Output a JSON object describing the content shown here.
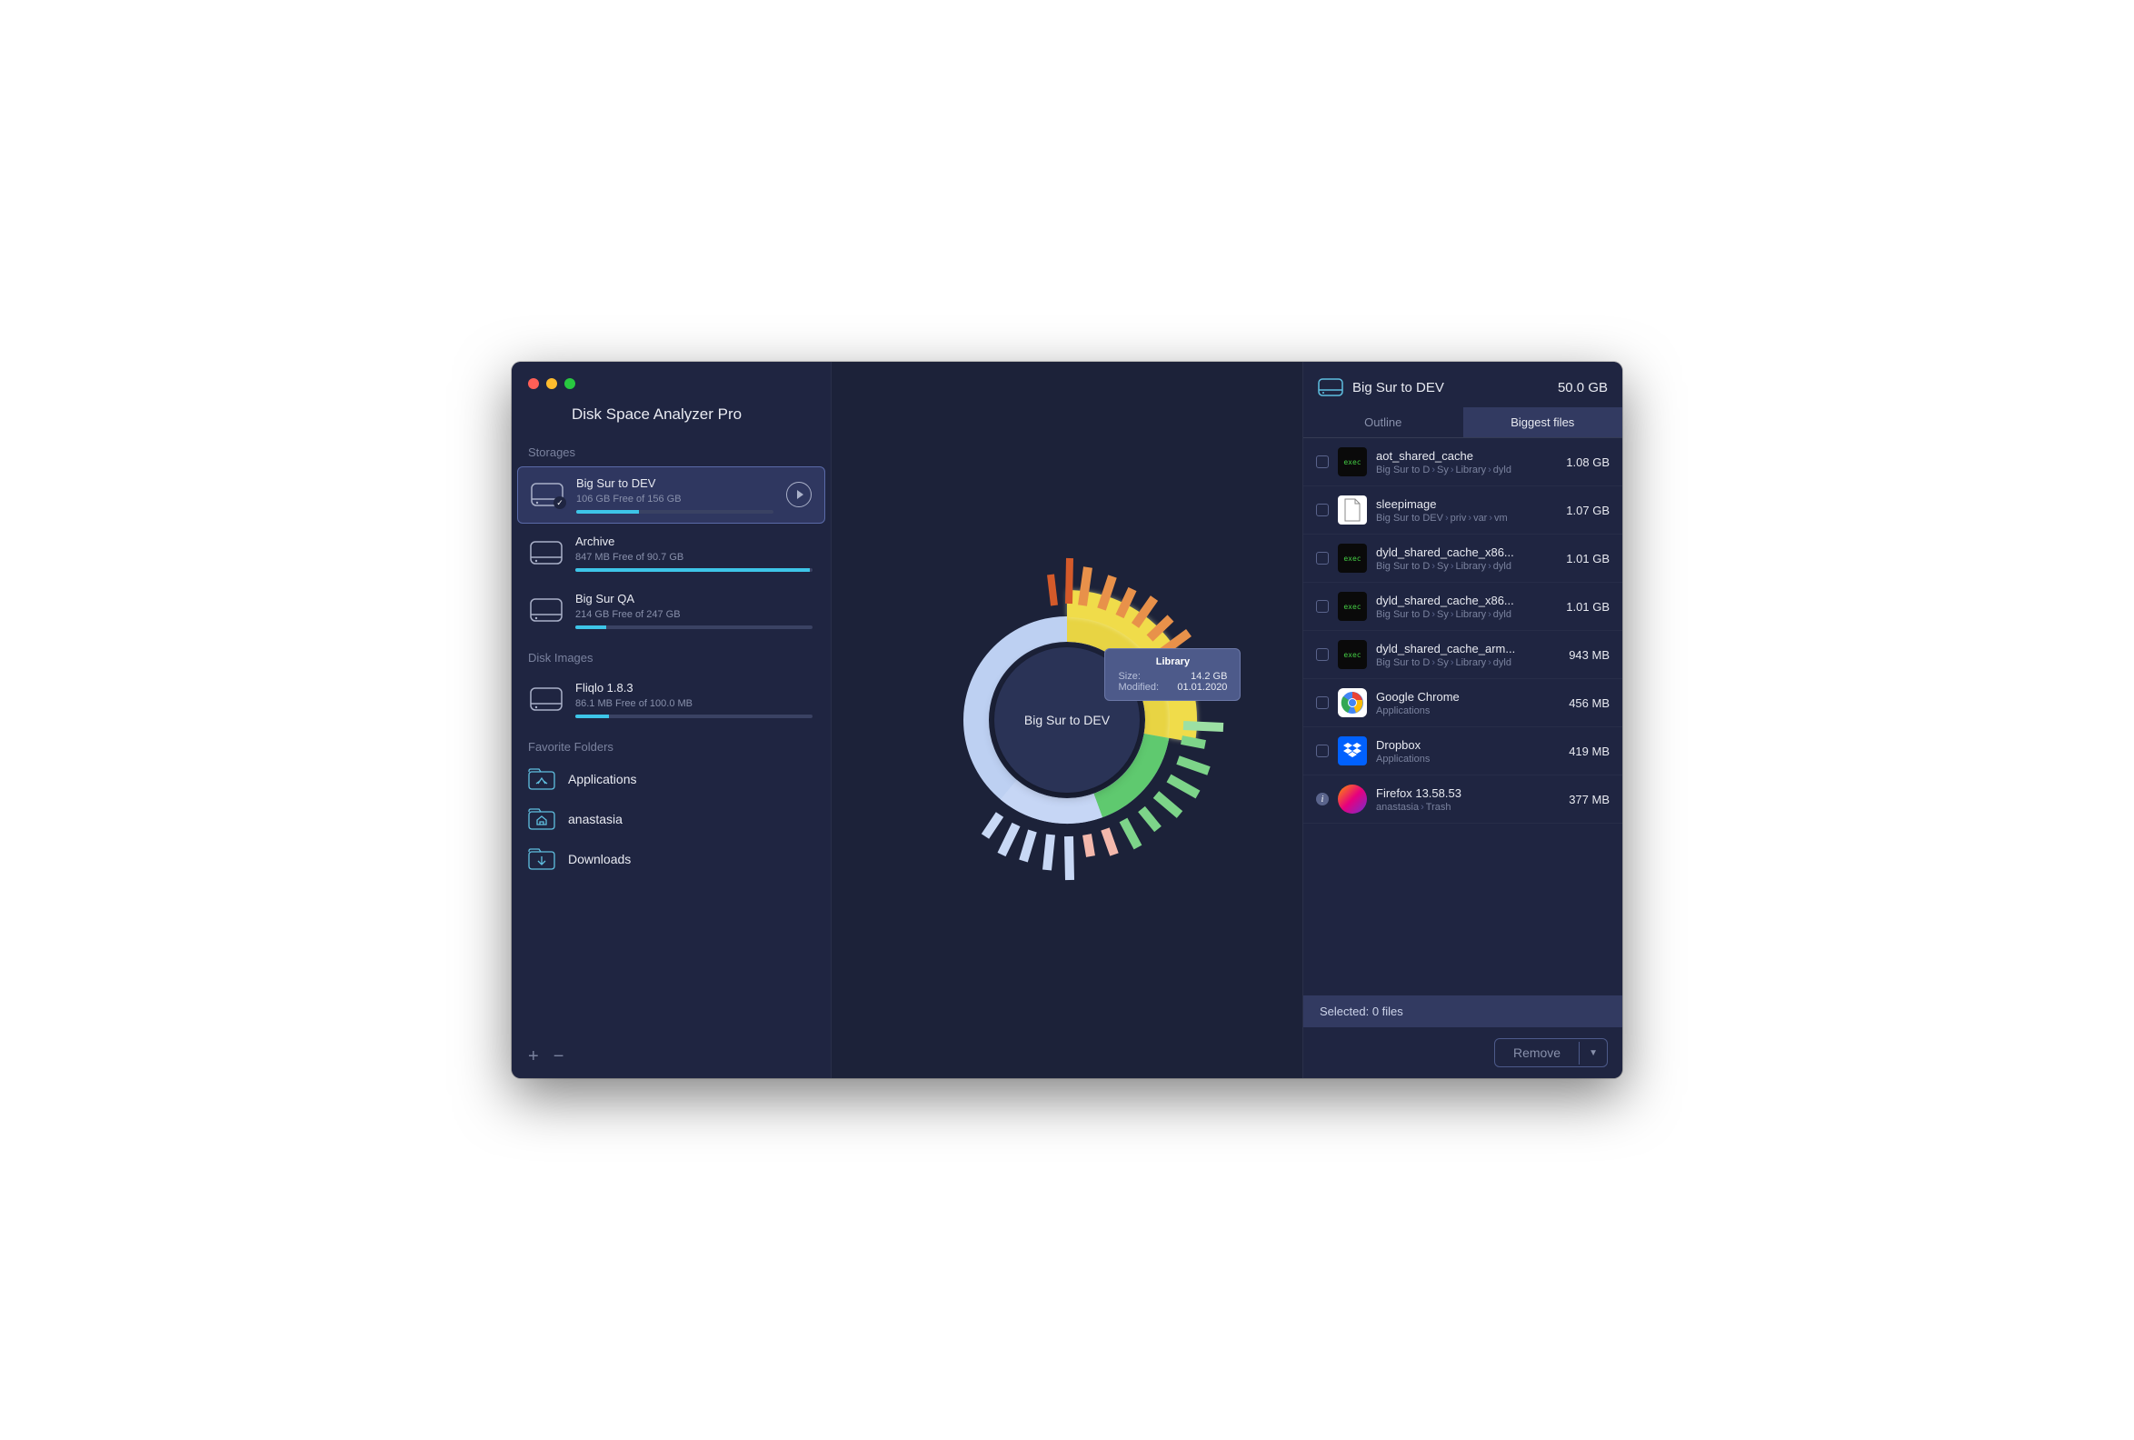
{
  "app_title": "Disk Space Analyzer Pro",
  "sidebar": {
    "storages_label": "Storages",
    "storages": [
      {
        "name": "Big Sur to DEV",
        "sub": "106 GB Free of 156 GB",
        "fill": 32,
        "active": true,
        "check": true,
        "play": true
      },
      {
        "name": "Archive",
        "sub": "847 MB Free of 90.7 GB",
        "fill": 99
      },
      {
        "name": "Big Sur QA",
        "sub": "214 GB Free of 247 GB",
        "fill": 13
      }
    ],
    "disk_images_label": "Disk Images",
    "disk_images": [
      {
        "name": "Fliqlo 1.8.3",
        "sub": "86.1 MB Free of 100.0 MB",
        "fill": 14
      }
    ],
    "favorites_label": "Favorite Folders",
    "favorites": [
      {
        "label": "Applications",
        "icon": "applications"
      },
      {
        "label": "anastasia",
        "icon": "home"
      },
      {
        "label": "Downloads",
        "icon": "downloads"
      }
    ]
  },
  "center": {
    "label": "Big Sur to DEV",
    "tooltip": {
      "title": "Library",
      "size_label": "Size:",
      "size_value": "14.2 GB",
      "modified_label": "Modified:",
      "modified_value": "01.01.2020"
    }
  },
  "right": {
    "header_title": "Big Sur to DEV",
    "header_size": "50.0 GB",
    "tabs": {
      "outline": "Outline",
      "biggest": "Biggest files"
    },
    "files": [
      {
        "name": "aot_shared_cache",
        "size": "1.08 GB",
        "path": [
          "Big Sur to D",
          "Sy",
          "Library",
          "dyld"
        ],
        "icon": "exec"
      },
      {
        "name": "sleepimage",
        "size": "1.07 GB",
        "path": [
          "Big Sur to DEV",
          "priv",
          "var",
          "vm"
        ],
        "icon": "doc"
      },
      {
        "name": "dyld_shared_cache_x86...",
        "size": "1.01 GB",
        "path": [
          "Big Sur to D",
          "Sy",
          "Library",
          "dyld"
        ],
        "icon": "exec"
      },
      {
        "name": "dyld_shared_cache_x86...",
        "size": "1.01 GB",
        "path": [
          "Big Sur to D",
          "Sy",
          "Library",
          "dyld"
        ],
        "icon": "exec"
      },
      {
        "name": "dyld_shared_cache_arm...",
        "size": "943 MB",
        "path": [
          "Big Sur to D",
          "Sy",
          "Library",
          "dyld"
        ],
        "icon": "exec"
      },
      {
        "name": "Google Chrome",
        "size": "456 MB",
        "path": [
          "Applications"
        ],
        "icon": "chrome"
      },
      {
        "name": "Dropbox",
        "size": "419 MB",
        "path": [
          "Applications"
        ],
        "icon": "dropbox"
      },
      {
        "name": "Firefox 13.58.53",
        "size": "377 MB",
        "path": [
          "anastasia",
          "Trash"
        ],
        "icon": "firefox",
        "info": true
      }
    ],
    "selected_label": "Selected: 0 files",
    "remove_label": "Remove"
  }
}
